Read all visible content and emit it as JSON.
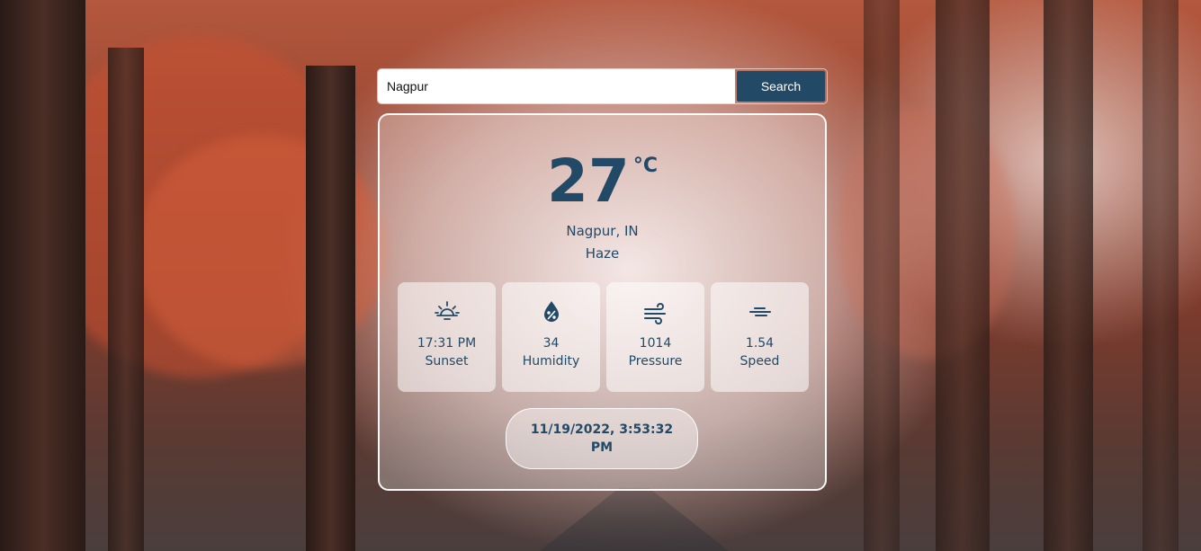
{
  "search": {
    "value": "Nagpur",
    "button_label": "Search"
  },
  "weather": {
    "temperature": "27",
    "unit": "°C",
    "location": "Nagpur, IN",
    "condition": "Haze",
    "stats": [
      {
        "icon": "sunset-icon",
        "value": "17:31 PM",
        "label": "Sunset"
      },
      {
        "icon": "humidity-icon",
        "value": "34",
        "label": "Humidity"
      },
      {
        "icon": "pressure-icon",
        "value": "1014",
        "label": "Pressure"
      },
      {
        "icon": "wind-speed-icon",
        "value": "1.54",
        "label": "Speed"
      }
    ],
    "datetime": "11/19/2022, 3:53:32 PM"
  },
  "colors": {
    "accent": "#224a66",
    "card_border": "#ffffff"
  }
}
